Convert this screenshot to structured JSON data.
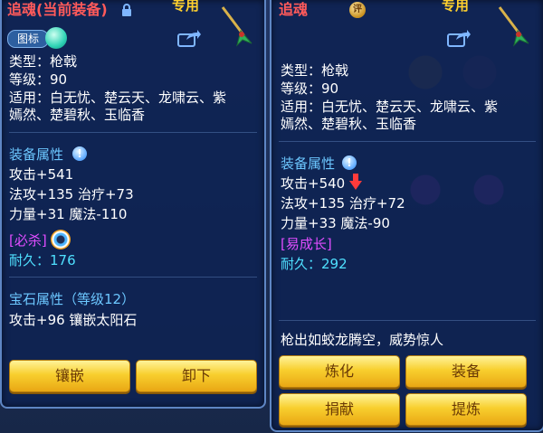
{
  "left": {
    "title": "追魂(当前装备)",
    "exclusive": "专用",
    "icon_tag": "图标",
    "type_line": "类型：枪戟",
    "level_line": "等级：90",
    "applies_line1": "适用：白无忧、楚云天、龙啸云、紫",
    "applies_line2": "嫣然、楚碧秋、玉临香",
    "attr_header": "装备属性",
    "attack": "攻击+541",
    "magic_line": "法攻+135 治疗+73",
    "strength_line": "力量+31 魔法-110",
    "special_tag": "[必杀]",
    "durability": "耐久：176",
    "gem_header": "宝石属性（等级12）",
    "gem_line": "攻击+96 镶嵌太阳石",
    "btn_inlay": "镶嵌",
    "btn_unequip": "卸下"
  },
  "right": {
    "title": "追魂",
    "exclusive": "专用",
    "badge": "评",
    "type_line": "类型：枪戟",
    "level_line": "等级：90",
    "applies_line1": "适用：白无忧、楚云天、龙啸云、紫",
    "applies_line2": "嫣然、楚碧秋、玉临香",
    "attr_header": "装备属性",
    "attack": "攻击+540",
    "magic_line": "法攻+135 治疗+72",
    "strength_line": "力量+33 魔法-90",
    "special_tag": "[易成长]",
    "durability": "耐久：292",
    "flavor": "枪出如蛟龙腾空，威势惊人",
    "btn_refine": "炼化",
    "btn_equip": "装备",
    "btn_donate": "捐献",
    "btn_extract": "提炼"
  },
  "icons": {
    "lock": "lock-icon",
    "share": "share-icon",
    "weapon": "spear-weapon-icon",
    "info": "info-icon",
    "down_arrow": "red-down-arrow-icon"
  },
  "colors": {
    "title_red": "#ff5a5a",
    "exclusive_gold": "#ffd02e",
    "section_blue": "#6cc7ff",
    "special_purple": "#e04dff",
    "durability_cyan": "#4fe0ff",
    "button_gold": "#f8cf2e"
  }
}
